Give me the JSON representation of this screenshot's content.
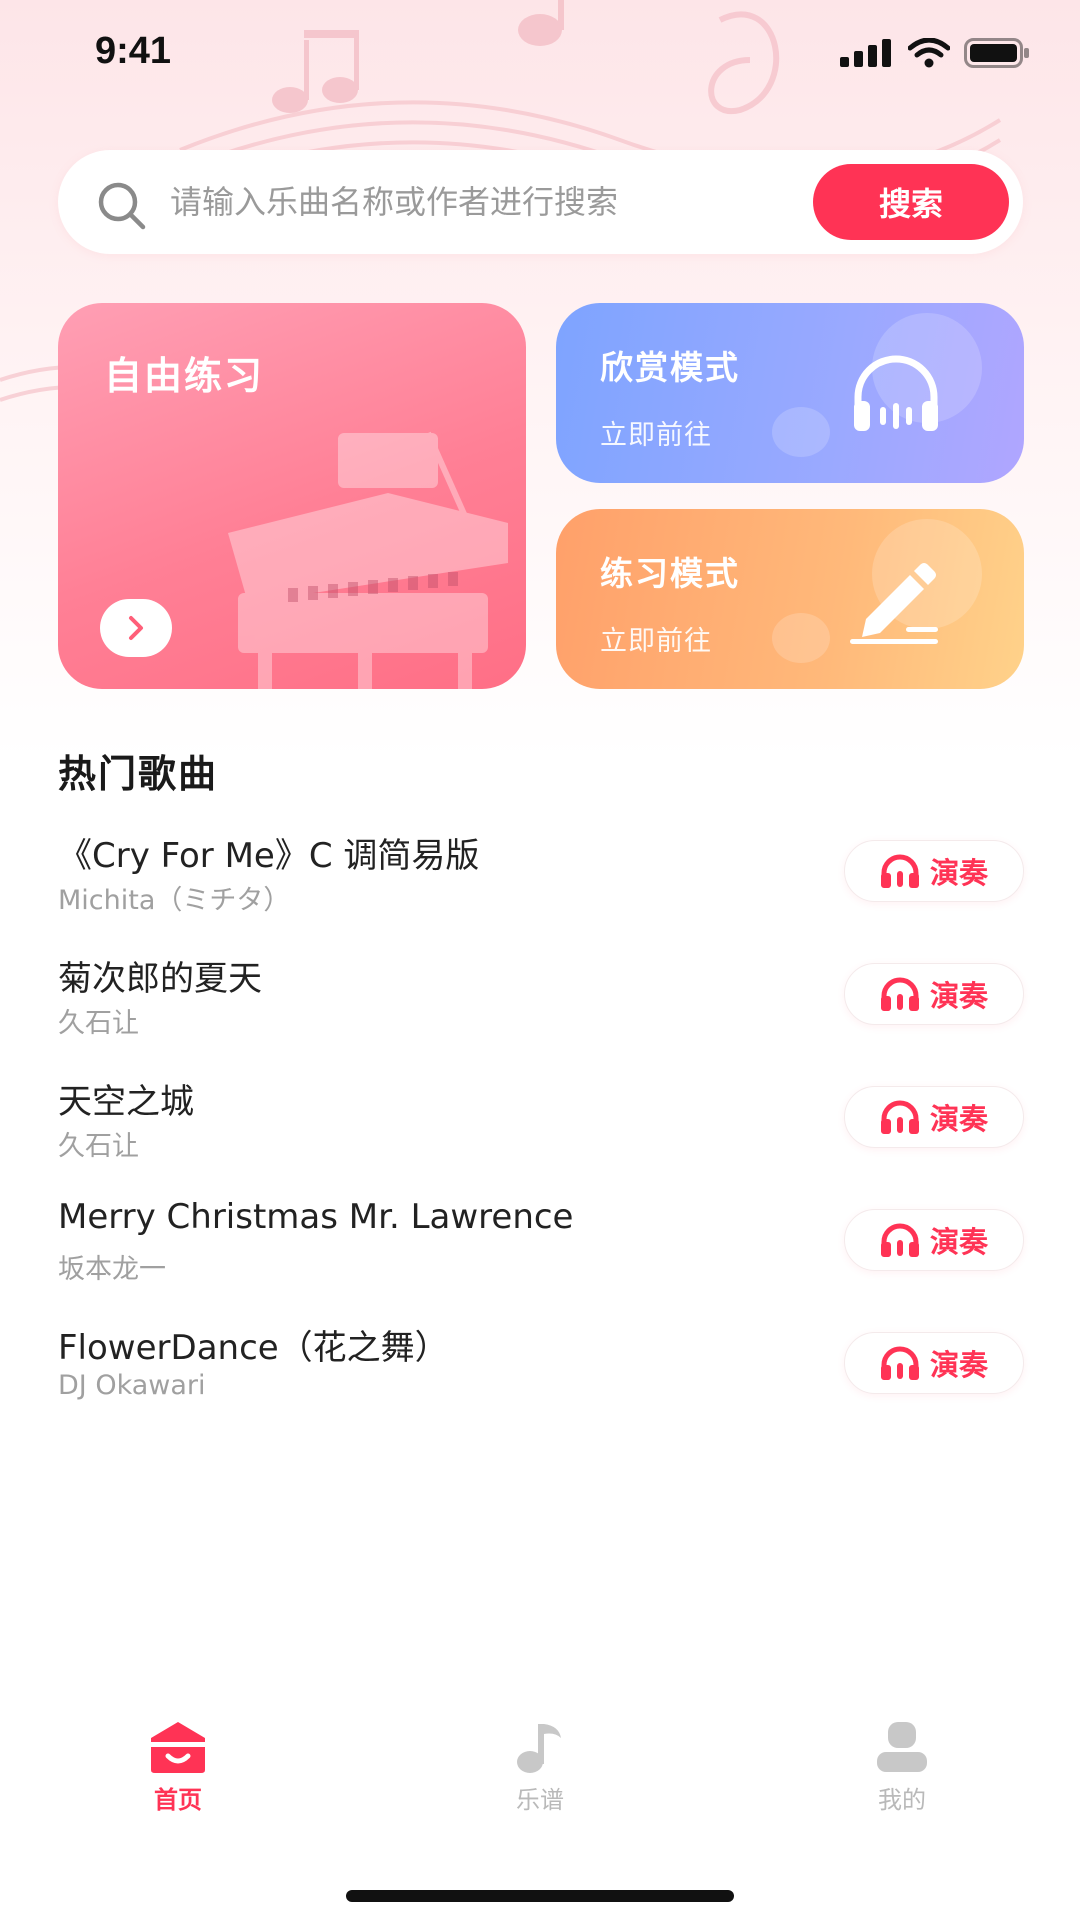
{
  "status_bar": {
    "time": "9:41"
  },
  "search": {
    "placeholder": "请输入乐曲名称或作者进行搜索",
    "value": "",
    "button_label": "搜索"
  },
  "cards": {
    "free_practice": {
      "title": "自由练习"
    },
    "appreciation": {
      "title": "欣赏模式",
      "subtitle": "立即前往"
    },
    "practice": {
      "title": "练习模式",
      "subtitle": "立即前往"
    }
  },
  "hot_songs": {
    "title": "热门歌曲",
    "play_label": "演奏",
    "items": [
      {
        "title": "《Cry For Me》C 调简易版",
        "artist": "Michita（ミチタ）"
      },
      {
        "title": "菊次郎的夏天",
        "artist": "久石让"
      },
      {
        "title": "天空之城",
        "artist": "久石让"
      },
      {
        "title": "Merry Christmas Mr. Lawrence",
        "artist": "坂本龙一"
      },
      {
        "title": "FlowerDance（花之舞）",
        "artist": "DJ Okawari"
      }
    ]
  },
  "tab_bar": {
    "items": [
      {
        "label": "首页",
        "icon": "home-icon",
        "active": true
      },
      {
        "label": "乐谱",
        "icon": "music-note-icon",
        "active": false
      },
      {
        "label": "我的",
        "icon": "profile-icon",
        "active": false
      }
    ]
  },
  "colors": {
    "accent": "#ff3355",
    "free_card": "#ff8298",
    "appreciation_card": "#8ea8ff",
    "practice_card": "#ffb37a"
  }
}
